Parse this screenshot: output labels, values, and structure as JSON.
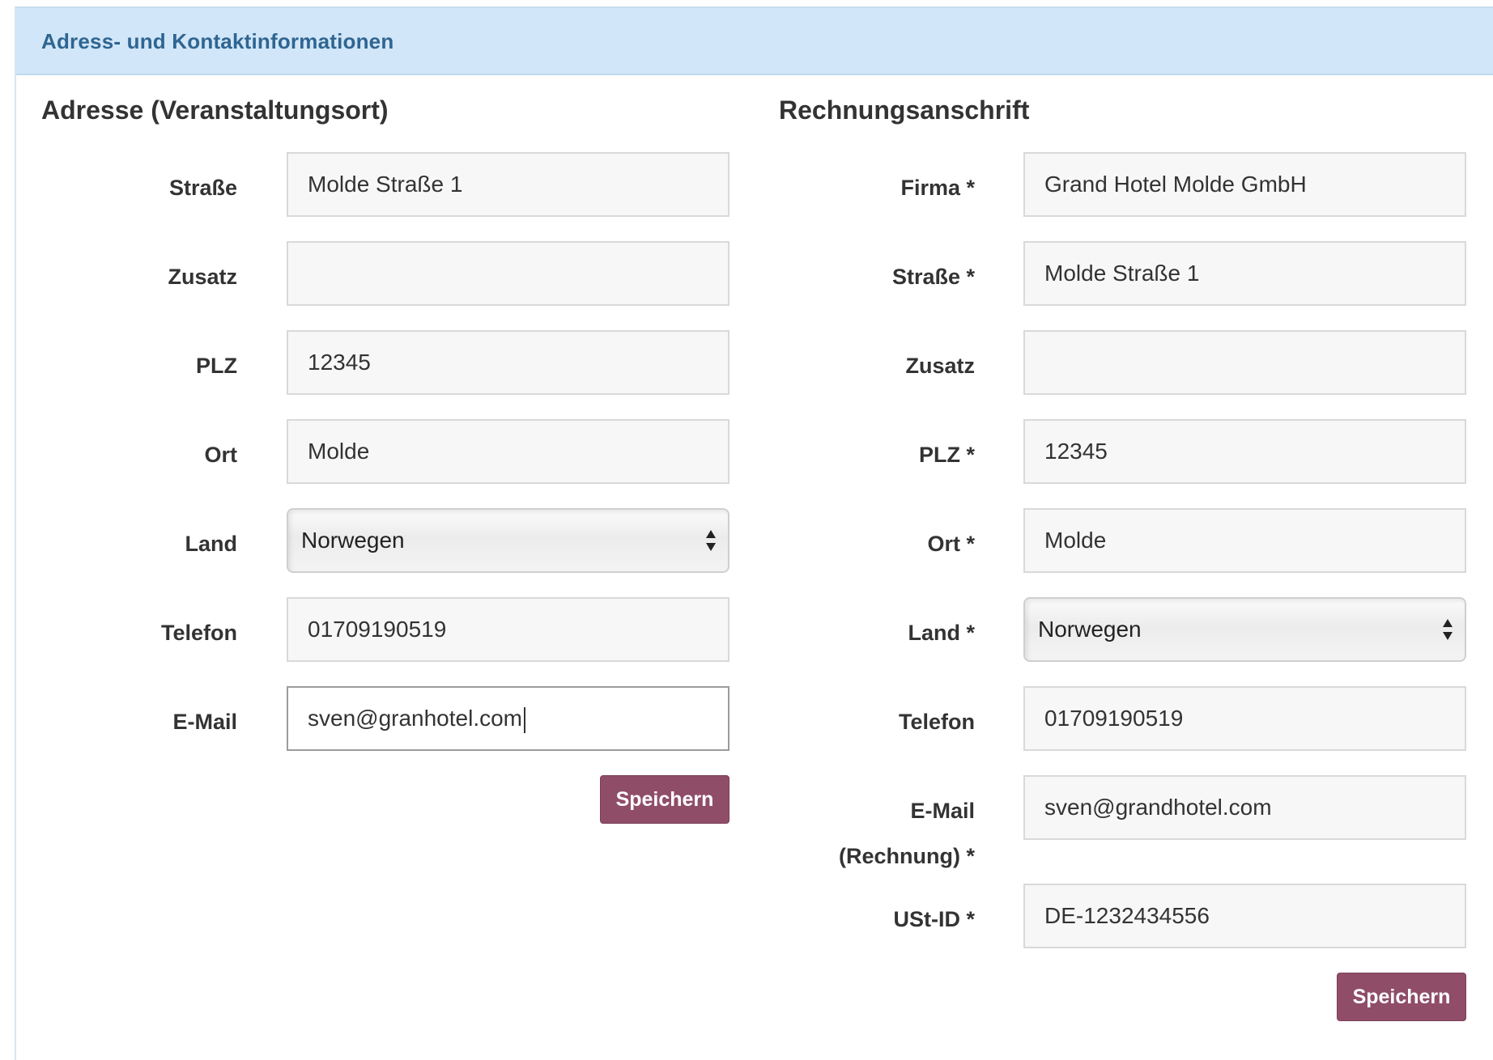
{
  "panel": {
    "title": "Adress- und Kontaktinformationen"
  },
  "venue": {
    "title": "Adresse (Veranstaltungsort)",
    "street_label": "Straße",
    "street_value": "Molde Straße 1",
    "extra_label": "Zusatz",
    "extra_value": "",
    "zip_label": "PLZ",
    "zip_value": "12345",
    "city_label": "Ort",
    "city_value": "Molde",
    "country_label": "Land",
    "country_value": "Norwegen",
    "phone_label": "Telefon",
    "phone_value": "01709190519",
    "email_label": "E-Mail",
    "email_value": "sven@granhotel.com",
    "save_label": "Speichern"
  },
  "billing": {
    "title": "Rechnungsanschrift",
    "company_label": "Firma *",
    "company_value": "Grand Hotel Molde GmbH",
    "street_label": "Straße *",
    "street_value": "Molde Straße 1",
    "extra_label": "Zusatz",
    "extra_value": "",
    "zip_label": "PLZ *",
    "zip_value": "12345",
    "city_label": "Ort *",
    "city_value": "Molde",
    "country_label": "Land *",
    "country_value": "Norwegen",
    "phone_label": "Telefon",
    "phone_value": "01709190519",
    "email_label_line1": "E-Mail",
    "email_label_line2": "(Rechnung) *",
    "email_value": "sven@grandhotel.com",
    "vat_label": "USt-ID *",
    "vat_value": "DE-1232434556",
    "save_label": "Speichern"
  },
  "icons": {
    "select_arrows": "up-down-arrows-icon"
  }
}
